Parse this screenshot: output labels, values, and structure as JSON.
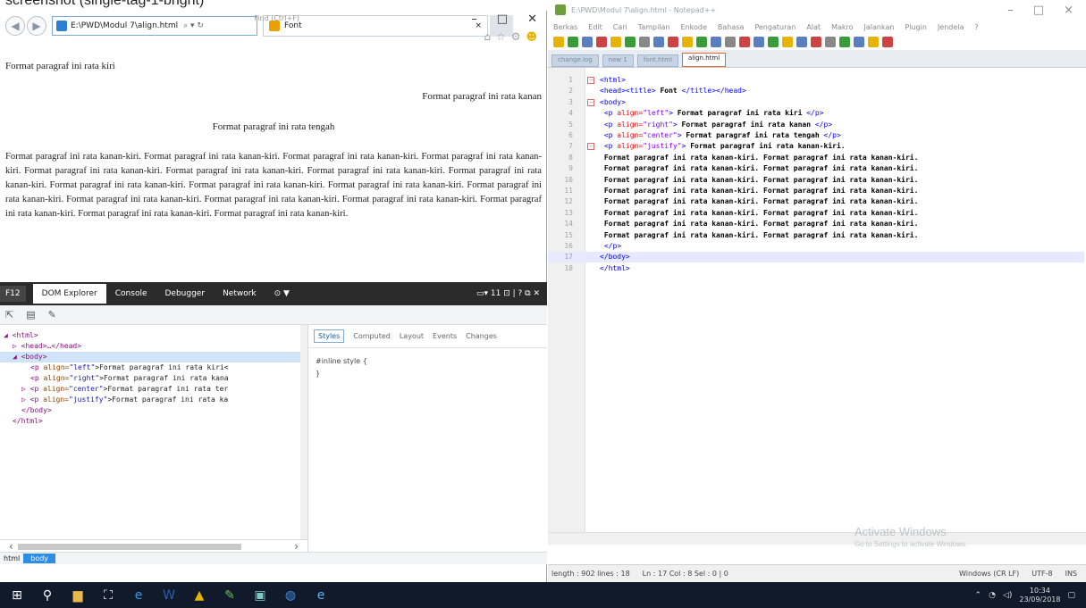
{
  "caption": "screenshot (single-tag-1-bright)",
  "ie": {
    "window_controls": [
      "–",
      "□",
      "✕"
    ],
    "address": "E:\\PWD\\Modul 7\\align.html",
    "address_icons": "⌕ ▾ ↻",
    "tab_title": "Font",
    "tab_close": "×",
    "page": {
      "p_left": "Format paragraf ini rata kiri",
      "p_right": "Format paragraf ini rata kanan",
      "p_center": "Format paragraf ini rata tengah",
      "p_justify": "Format paragraf ini rata kanan-kiri. Format paragraf ini rata kanan-kiri. Format paragraf ini rata kanan-kiri. Format paragraf ini rata kanan-kiri. Format paragraf ini rata kanan-kiri. Format paragraf ini rata kanan-kiri. Format paragraf ini rata kanan-kiri. Format paragraf ini rata kanan-kiri. Format paragraf ini rata kanan-kiri. Format paragraf ini rata kanan-kiri. Format paragraf ini rata kanan-kiri. Format paragraf ini rata kanan-kiri. Format paragraf ini rata kanan-kiri. Format paragraf ini rata kanan-kiri. Format paragraf ini rata kanan-kiri. Format paragraf ini rata kanan-kiri. Format paragraf ini rata kanan-kiri. Format paragraf ini rata kanan-kiri."
    }
  },
  "devtools": {
    "f12": "F12",
    "tabs": [
      "DOM Explorer",
      "Console",
      "Debugger",
      "Network"
    ],
    "controls": "▭▾ 11   ⊡ | ? ⧉ ✕",
    "find": "Find (Ctrl+F)",
    "dom_lines": [
      {
        "indent": 0,
        "open": "◢ <html>",
        "attr": "",
        "val": "",
        "text": ""
      },
      {
        "indent": 1,
        "open": "▷ <head>…</head>",
        "attr": "",
        "val": "",
        "text": ""
      },
      {
        "indent": 1,
        "open": "◢ <body>",
        "attr": "",
        "val": "",
        "text": ""
      },
      {
        "indent": 3,
        "open": "<p ",
        "attr": "align=",
        "val": "\"left\"",
        "text": ">Format paragraf ini rata kiri<"
      },
      {
        "indent": 3,
        "open": "<p ",
        "attr": "align=",
        "val": "\"right\"",
        "text": ">Format paragraf ini rata kana"
      },
      {
        "indent": 2,
        "open": "▷ <p ",
        "attr": "align=",
        "val": "\"center\"",
        "text": ">Format paragraf ini rata ter"
      },
      {
        "indent": 2,
        "open": "▷ <p ",
        "attr": "align=",
        "val": "\"justify\"",
        "text": ">Format paragraf ini rata ka"
      },
      {
        "indent": 2,
        "open": "</body>",
        "attr": "",
        "val": "",
        "text": ""
      },
      {
        "indent": 1,
        "open": "</html>",
        "attr": "",
        "val": "",
        "text": ""
      }
    ],
    "styles_tabs": [
      "Styles",
      "Computed",
      "Layout",
      "Events",
      "Changes"
    ],
    "inline_style": "#inline style  {",
    "close_brace": "}",
    "crumb": [
      "html",
      "body"
    ]
  },
  "notepad": {
    "title": "E:\\PWD\\Modul 7\\align.html - Notepad++",
    "window_controls": [
      "–",
      "□",
      "×"
    ],
    "menu": [
      "Berkas",
      "Edit",
      "Cari",
      "Tampilan",
      "Enkode",
      "Bahasa",
      "Pengaturan",
      "Alat",
      "Makro",
      "Jalankan",
      "Plugin",
      "Jendela",
      "?"
    ],
    "tabs": [
      "change.log",
      "new 1",
      "font.html",
      "align.html"
    ],
    "code_lines": [
      {
        "n": "1",
        "parts": [
          {
            "c": "tag",
            "t": "<html>"
          }
        ]
      },
      {
        "n": "2",
        "parts": [
          {
            "c": "tag",
            "t": "<head><title>"
          },
          {
            "c": "tx",
            "t": " Font "
          },
          {
            "c": "tag",
            "t": "</title></head>"
          }
        ]
      },
      {
        "n": "3",
        "parts": [
          {
            "c": "tag",
            "t": "<body>"
          }
        ]
      },
      {
        "n": "4",
        "parts": [
          {
            "c": "tag",
            "t": "<p "
          },
          {
            "c": "atr",
            "t": "align="
          },
          {
            "c": "str",
            "t": "\"left\""
          },
          {
            "c": "tag",
            "t": ">"
          },
          {
            "c": "tx",
            "t": " Format paragraf ini rata kiri "
          },
          {
            "c": "tag",
            "t": "</p>"
          }
        ]
      },
      {
        "n": "5",
        "parts": [
          {
            "c": "tag",
            "t": "<p "
          },
          {
            "c": "atr",
            "t": "align="
          },
          {
            "c": "str",
            "t": "\"right\""
          },
          {
            "c": "tag",
            "t": ">"
          },
          {
            "c": "tx",
            "t": " Format paragraf ini rata kanan "
          },
          {
            "c": "tag",
            "t": "</p>"
          }
        ]
      },
      {
        "n": "6",
        "parts": [
          {
            "c": "tag",
            "t": "<p "
          },
          {
            "c": "atr",
            "t": "align="
          },
          {
            "c": "str",
            "t": "\"center\""
          },
          {
            "c": "tag",
            "t": ">"
          },
          {
            "c": "tx",
            "t": " Format paragraf ini rata tengah "
          },
          {
            "c": "tag",
            "t": "</p>"
          }
        ]
      },
      {
        "n": "7",
        "parts": [
          {
            "c": "tag",
            "t": "<p "
          },
          {
            "c": "atr",
            "t": "align="
          },
          {
            "c": "str",
            "t": "\"justify\""
          },
          {
            "c": "tag",
            "t": ">"
          },
          {
            "c": "tx",
            "t": " Format paragraf ini rata kanan-kiri."
          }
        ]
      },
      {
        "n": "8",
        "parts": [
          {
            "c": "tx",
            "t": "Format paragraf ini rata kanan-kiri. Format paragraf ini rata kanan-kiri."
          }
        ]
      },
      {
        "n": "9",
        "parts": [
          {
            "c": "tx",
            "t": "Format paragraf ini rata kanan-kiri. Format paragraf ini rata kanan-kiri."
          }
        ]
      },
      {
        "n": "10",
        "parts": [
          {
            "c": "tx",
            "t": "Format paragraf ini rata kanan-kiri. Format paragraf ini rata kanan-kiri."
          }
        ]
      },
      {
        "n": "11",
        "parts": [
          {
            "c": "tx",
            "t": "Format paragraf ini rata kanan-kiri. Format paragraf ini rata kanan-kiri."
          }
        ]
      },
      {
        "n": "12",
        "parts": [
          {
            "c": "tx",
            "t": "Format paragraf ini rata kanan-kiri. Format paragraf ini rata kanan-kiri."
          }
        ]
      },
      {
        "n": "13",
        "parts": [
          {
            "c": "tx",
            "t": "Format paragraf ini rata kanan-kiri. Format paragraf ini rata kanan-kiri."
          }
        ]
      },
      {
        "n": "14",
        "parts": [
          {
            "c": "tx",
            "t": "Format paragraf ini rata kanan-kiri. Format paragraf ini rata kanan-kiri."
          }
        ]
      },
      {
        "n": "15",
        "parts": [
          {
            "c": "tx",
            "t": "Format paragraf ini rata kanan-kiri. Format paragraf ini rata kanan-kiri."
          }
        ]
      },
      {
        "n": "16",
        "parts": [
          {
            "c": "tag",
            "t": "</p>"
          }
        ]
      },
      {
        "n": "17",
        "parts": [
          {
            "c": "tag",
            "t": "</body>"
          }
        ]
      },
      {
        "n": "18",
        "parts": [
          {
            "c": "tag",
            "t": "</html>"
          }
        ]
      }
    ],
    "current_line": "17",
    "status": {
      "length": "length : 902    lines : 18",
      "pos": "Ln : 17    Col : 8    Sel : 0 | 0",
      "eol": "Windows (CR LF)",
      "enc": "UTF-8",
      "ins": "INS"
    }
  },
  "watermark": {
    "title": "Activate Windows",
    "sub": "Go to Settings to activate Windows."
  },
  "taskbar": {
    "time": "10:34",
    "date": "23/09/2018"
  },
  "colors": {
    "taskbar": "#101a2b",
    "accent": "#2e8ee6",
    "tag": "#0000ff",
    "attr": "#ff0000",
    "string": "#8000ff"
  }
}
